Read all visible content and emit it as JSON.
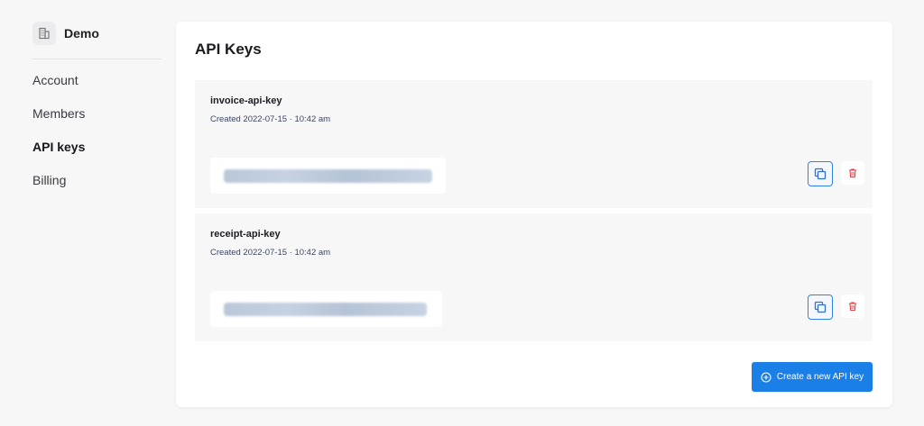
{
  "sidebar": {
    "org_name": "Demo",
    "org_icon": "building-icon",
    "items": [
      {
        "label": "Account",
        "active": false
      },
      {
        "label": "Members",
        "active": false
      },
      {
        "label": "API keys",
        "active": true
      },
      {
        "label": "Billing",
        "active": false
      }
    ]
  },
  "main": {
    "title": "API Keys",
    "keys": [
      {
        "name": "invoice-api-key",
        "created": "Created 2022-07-15 · 10:42 am",
        "value": "••••••••••••••••••••••••••••••••••••••••",
        "copy_icon": "copy-icon",
        "delete_icon": "trash-icon"
      },
      {
        "name": "receipt-api-key",
        "created": "Created 2022-07-15 · 10:42 am",
        "value": "••••••••••••••••••••••••••••••••••••••••",
        "copy_icon": "copy-icon",
        "delete_icon": "trash-icon"
      }
    ],
    "create_button": {
      "label": "Create a new API key",
      "icon": "plus-circle-icon"
    }
  },
  "colors": {
    "accent": "#1b7fe8",
    "delete": "#e0474c",
    "background": "#f7f7f8"
  }
}
